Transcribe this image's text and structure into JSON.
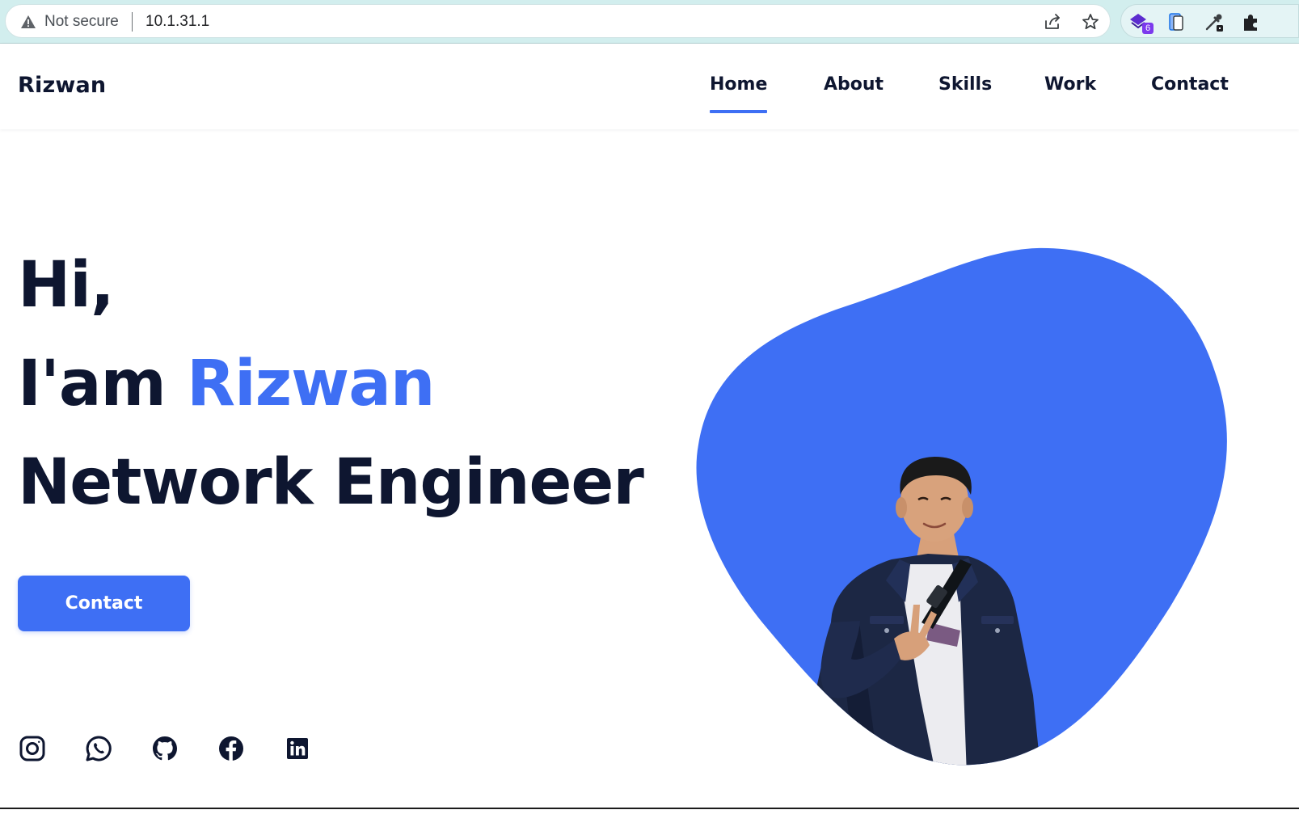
{
  "browser": {
    "security_label": "Not secure",
    "url": "10.1.31.1",
    "extensions": [
      {
        "icon": "stack-extension-icon",
        "badge": "6",
        "color": "#5b2ccf"
      },
      {
        "icon": "device-frame-extension-icon",
        "color": "#1a73e8"
      },
      {
        "icon": "eyedropper-extension-icon",
        "color": "#3c4043"
      },
      {
        "icon": "puzzle-extensions-icon",
        "color": "#202124"
      }
    ]
  },
  "site": {
    "logo": "Rizwan",
    "nav": [
      {
        "label": "Home",
        "active": true
      },
      {
        "label": "About",
        "active": false
      },
      {
        "label": "Skills",
        "active": false
      },
      {
        "label": "Work",
        "active": false
      },
      {
        "label": "Contact",
        "active": false
      }
    ]
  },
  "hero": {
    "greeting": "Hi,",
    "intro_prefix": "I'am ",
    "name": "Rizwan",
    "role": "Network Engineer",
    "cta_label": "Contact",
    "social_icons": [
      "instagram-icon",
      "whatsapp-icon",
      "github-icon",
      "facebook-icon",
      "linkedin-icon"
    ]
  },
  "colors": {
    "accent": "#3e6ff4",
    "text": "#0e1630",
    "chrome_bg": "#d2eeee"
  }
}
